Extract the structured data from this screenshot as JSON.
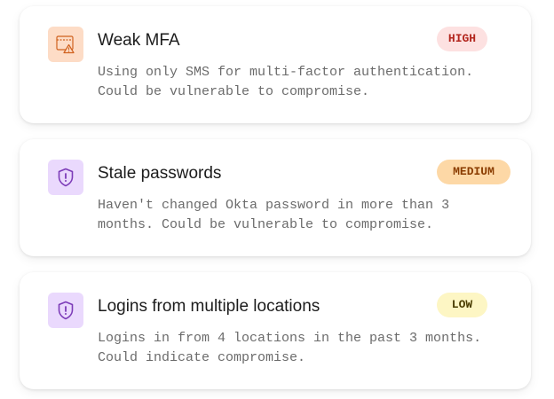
{
  "colors": {
    "high_bg": "#fde1e1",
    "high_text": "#b3261e",
    "medium_bg": "#fdd8a6",
    "medium_text": "#8a3c00",
    "low_bg": "#fdf6c4",
    "low_text": "#4a3d00",
    "warn_tile_bg": "#fddcc6",
    "warn_icon": "#d0611e",
    "shield_tile_bg": "#ead9fd",
    "shield_icon": "#7c3bb8"
  },
  "alerts": [
    {
      "title": "Weak MFA",
      "severity": "HIGH",
      "icon": "browser-warning-icon",
      "description": "Using only SMS for multi-factor authentication. Could be vulnerable to compromise."
    },
    {
      "title": "Stale passwords",
      "severity": "MEDIUM",
      "icon": "shield-alert-icon",
      "description": "Haven't changed Okta password in more than 3 months. Could be vulnerable to compromise."
    },
    {
      "title": "Logins from multiple locations",
      "severity": "LOW",
      "icon": "shield-alert-icon",
      "description": "Logins in from 4 locations in the past 3 months. Could indicate compromise."
    }
  ]
}
